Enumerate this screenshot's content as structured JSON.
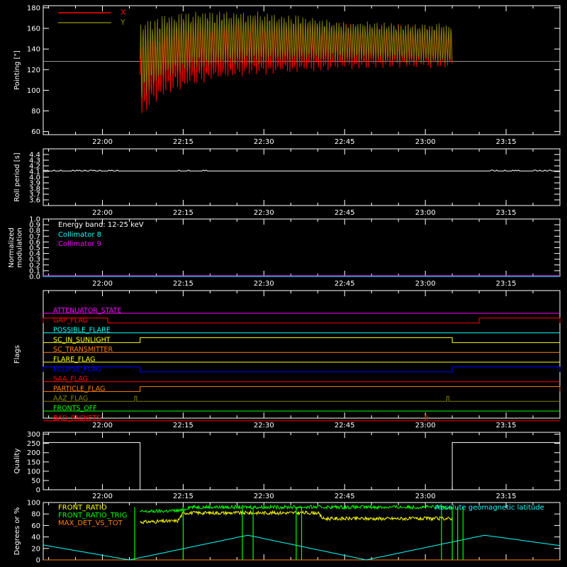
{
  "time_axis": {
    "start": "21:49",
    "end": "23:25",
    "tick_labels": [
      "22:00",
      "22:15",
      "22:30",
      "22:45",
      "23:00",
      "23:15"
    ]
  },
  "colors": {
    "background": "#000000",
    "axis": "#ffffff",
    "x_series": "#ff0000",
    "y_series": "#808000",
    "cyan": "#00ffff",
    "magenta": "#ff00ff",
    "green": "#00ff00",
    "yellow": "#ffff00",
    "orange": "#ff8000",
    "blue": "#0000ff",
    "red": "#ff0000"
  },
  "chart_data": [
    {
      "id": "pointing",
      "type": "line",
      "ylabel": "Pointing [\"]",
      "ylim": [
        57,
        182
      ],
      "yticks": [
        60,
        80,
        100,
        120,
        140,
        160,
        180
      ],
      "legend_position": "top-left",
      "reference_line": 128,
      "data_window": [
        "22:07",
        "23:05"
      ],
      "series": [
        {
          "name": "X",
          "color": "#ff0000",
          "x": [
            "22:07",
            "22:09",
            "22:12",
            "22:16",
            "22:20",
            "22:25",
            "22:30",
            "22:35",
            "22:40",
            "22:45",
            "22:50",
            "22:55",
            "23:00",
            "23:05"
          ],
          "upper": [
            155,
            160,
            165,
            170,
            172,
            173,
            172,
            170,
            168,
            167,
            166,
            165,
            164,
            163
          ],
          "lower": [
            70,
            84,
            95,
            102,
            108,
            111,
            114,
            116,
            118,
            119,
            121,
            121,
            121,
            121
          ]
        },
        {
          "name": "Y",
          "color": "#808000",
          "x": [
            "22:07",
            "22:09",
            "22:12",
            "22:16",
            "22:20",
            "22:25",
            "22:30",
            "22:35",
            "22:40",
            "22:45",
            "22:50",
            "22:55",
            "23:00",
            "23:05"
          ],
          "upper": [
            168,
            172,
            175,
            178,
            178,
            178,
            176,
            174,
            171,
            168,
            167,
            166,
            166,
            165
          ],
          "lower": [
            87,
            100,
            112,
            117,
            121,
            123,
            125,
            126,
            127,
            127,
            127,
            126,
            125,
            124
          ]
        }
      ]
    },
    {
      "id": "roll_period",
      "type": "line",
      "ylabel": "Roll period [s]",
      "ylim": [
        3.5,
        4.5
      ],
      "yticks": [
        3.6,
        3.7,
        3.8,
        3.9,
        4.0,
        4.1,
        4.2,
        4.3,
        4.4
      ],
      "series": [
        {
          "color": "#ffffff",
          "x": [
            "21:49",
            "23:25"
          ],
          "y": [
            4.11,
            4.11
          ]
        }
      ]
    },
    {
      "id": "modulation",
      "type": "line",
      "ylabel": "Normalized modulation",
      "ylim": [
        0,
        1.0
      ],
      "yticks": [
        0.0,
        0.1,
        0.2,
        0.3,
        0.4,
        0.5,
        0.6,
        0.7,
        0.8,
        0.9,
        1.0
      ],
      "annotations": [
        "Energy band: 12-25 keV"
      ],
      "series": [
        {
          "name": "Collimator 8",
          "color": "#00ffff",
          "x": [
            "21:49",
            "23:25"
          ],
          "y": [
            0,
            0
          ]
        },
        {
          "name": "Collimator 9",
          "color": "#ff00ff",
          "x": [
            "21:49",
            "23:25"
          ],
          "y": [
            0,
            0
          ]
        }
      ]
    },
    {
      "id": "flags",
      "type": "line",
      "ylabel": "Flags",
      "flags": [
        {
          "name": "ATTENUATOR_STATE",
          "color": "#ff00ff",
          "high": []
        },
        {
          "name": "GAP_FLAG",
          "color": "#ff0000",
          "high": [
            [
              "21:49",
              "22:01"
            ],
            [
              "23:10",
              "23:25"
            ]
          ]
        },
        {
          "name": "POSSIBLE_FLARE",
          "color": "#00ffff",
          "high": []
        },
        {
          "name": "SC_IN_SUNLIGHT",
          "color": "#ffff00",
          "high": [
            [
              "22:07",
              "23:05"
            ]
          ]
        },
        {
          "name": "SC_TRANSMITTER",
          "color": "#ff8000",
          "high": []
        },
        {
          "name": "FLARE_FLAG",
          "color": "#ffff00",
          "high": []
        },
        {
          "name": "ECLIPSE_FLAG",
          "color": "#0000ff",
          "high": [
            [
              "21:49",
              "22:07"
            ],
            [
              "23:05",
              "23:25"
            ]
          ]
        },
        {
          "name": "SAA_FLAG",
          "color": "#ff0000",
          "high": []
        },
        {
          "name": "PARTICLE_FLAG",
          "color": "#ff8000",
          "high": [
            [
              "22:07",
              "23:25"
            ]
          ]
        },
        {
          "name": "AAZ_FLAG",
          "color": "#808000",
          "high": [
            [
              "22:06",
              "22:06"
            ],
            [
              "23:04",
              "23:04"
            ]
          ]
        },
        {
          "name": "FRONTS_OFF",
          "color": "#00ff00",
          "high": []
        },
        {
          "name": "BAD_PACKETS",
          "color": "#ff0000",
          "high": [
            [
              "23:00",
              "23:00"
            ]
          ]
        }
      ]
    },
    {
      "id": "quality",
      "type": "line",
      "ylabel": "Quality",
      "ylim": [
        0,
        310
      ],
      "yticks": [
        0,
        50,
        100,
        150,
        200,
        250,
        300
      ],
      "series": [
        {
          "color": "#ffffff",
          "x": [
            "21:49",
            "22:07",
            "22:07",
            "23:05",
            "23:05",
            "23:25"
          ],
          "y": [
            255,
            255,
            0,
            0,
            255,
            255
          ]
        }
      ]
    },
    {
      "id": "degrees",
      "type": "line",
      "ylabel": "Degrees or %",
      "ylim": [
        0,
        100
      ],
      "yticks": [
        0,
        20,
        40,
        60,
        80,
        100
      ],
      "series": [
        {
          "name": "FRONT_RATIO",
          "color": "#ffff00",
          "x": [
            "22:07",
            "22:14",
            "22:15",
            "22:40",
            "22:41",
            "23:05"
          ],
          "y": [
            66,
            68,
            82,
            82,
            72,
            72
          ]
        },
        {
          "name": "FRONT_RATIO_TRIG",
          "color": "#00ff00",
          "x": [
            "22:07",
            "22:15",
            "22:16",
            "23:05"
          ],
          "y": [
            84,
            86,
            92,
            92
          ]
        },
        {
          "name": "MAX_DET_VS_TOT",
          "color": "#ff8000",
          "x": [
            "21:49",
            "23:25"
          ],
          "y": [
            0,
            0
          ]
        },
        {
          "name": "Absolute geomagnetic latitude",
          "color": "#00ffff",
          "x": [
            "21:49",
            "22:05",
            "22:27",
            "22:49",
            "23:11",
            "23:25"
          ],
          "y": [
            26,
            0,
            43,
            0,
            43,
            25
          ]
        }
      ]
    }
  ]
}
